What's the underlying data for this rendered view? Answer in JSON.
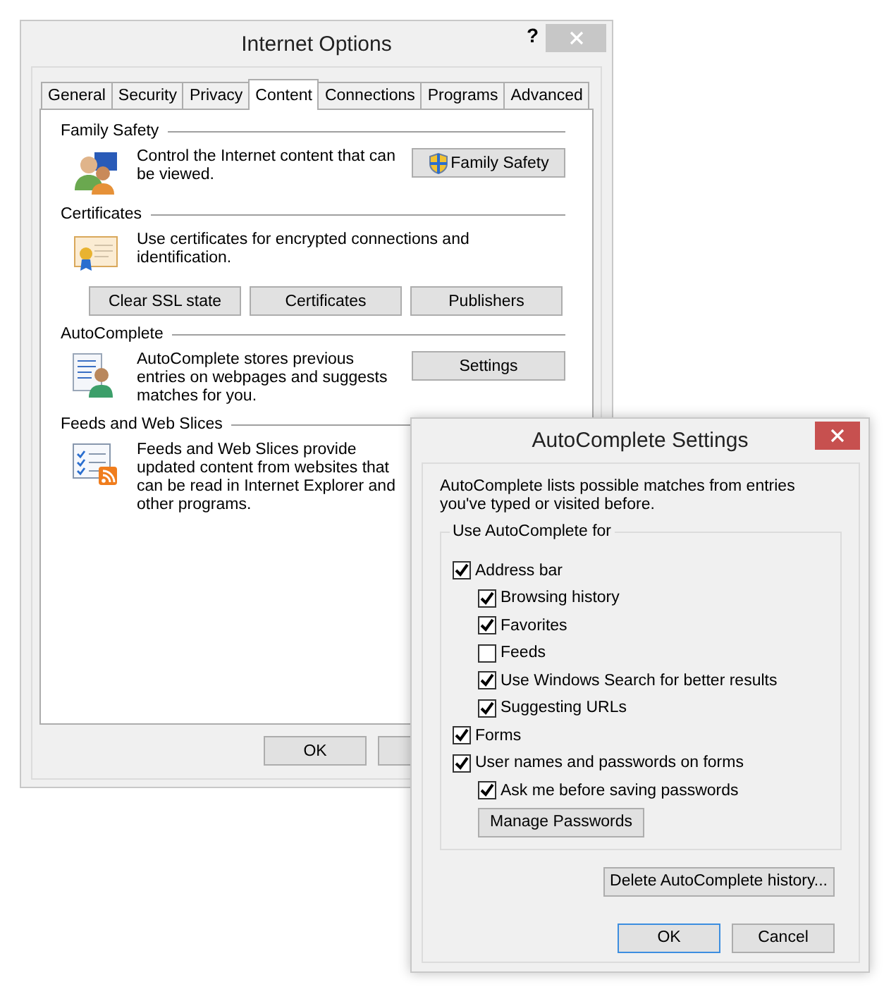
{
  "internet_options": {
    "title": "Internet Options",
    "help": "?",
    "tabs": [
      {
        "label": "General",
        "selected": false
      },
      {
        "label": "Security",
        "selected": false
      },
      {
        "label": "Privacy",
        "selected": false
      },
      {
        "label": "Content",
        "selected": true
      },
      {
        "label": "Connections",
        "selected": false
      },
      {
        "label": "Programs",
        "selected": false
      },
      {
        "label": "Advanced",
        "selected": false
      }
    ],
    "sections": [
      {
        "kind": "family",
        "title": "Family Safety",
        "text": "Control the Internet content that can be viewed.",
        "button": "Family Safety"
      },
      {
        "kind": "certificates",
        "title": "Certificates",
        "text": "Use certificates for encrypted connections and identification.",
        "buttons": [
          "Clear SSL state",
          "Certificates",
          "Publishers"
        ]
      },
      {
        "kind": "autocomplete",
        "title": "AutoComplete",
        "text": "AutoComplete stores previous entries on webpages and suggests matches for you.",
        "button": "Settings"
      },
      {
        "kind": "feeds",
        "title": "Feeds and Web Slices",
        "text": "Feeds and Web Slices provide updated content from websites that can be read in Internet Explorer and other programs."
      }
    ],
    "buttons": [
      "OK"
    ]
  },
  "autocomplete_settings": {
    "title": "AutoComplete Settings",
    "description": "AutoComplete lists possible matches from entries you've typed or visited before.",
    "group_title": "Use AutoComplete for",
    "options": [
      {
        "label": "Address bar",
        "checked": true,
        "children": [
          {
            "label": "Browsing history",
            "checked": true
          },
          {
            "label": "Favorites",
            "checked": true
          },
          {
            "label": "Feeds",
            "checked": false
          },
          {
            "label": "Use Windows Search for better results",
            "checked": true
          },
          {
            "label": "Suggesting URLs",
            "checked": true
          }
        ]
      },
      {
        "label": "Forms",
        "checked": true
      },
      {
        "label": "User names and passwords on forms",
        "checked": true,
        "children": [
          {
            "label": "Ask me before saving passwords",
            "checked": true
          }
        ],
        "button": "Manage Passwords"
      }
    ],
    "delete_button": "Delete AutoComplete history...",
    "buttons": [
      {
        "label": "OK",
        "default": true
      },
      {
        "label": "Cancel",
        "default": false
      }
    ]
  }
}
